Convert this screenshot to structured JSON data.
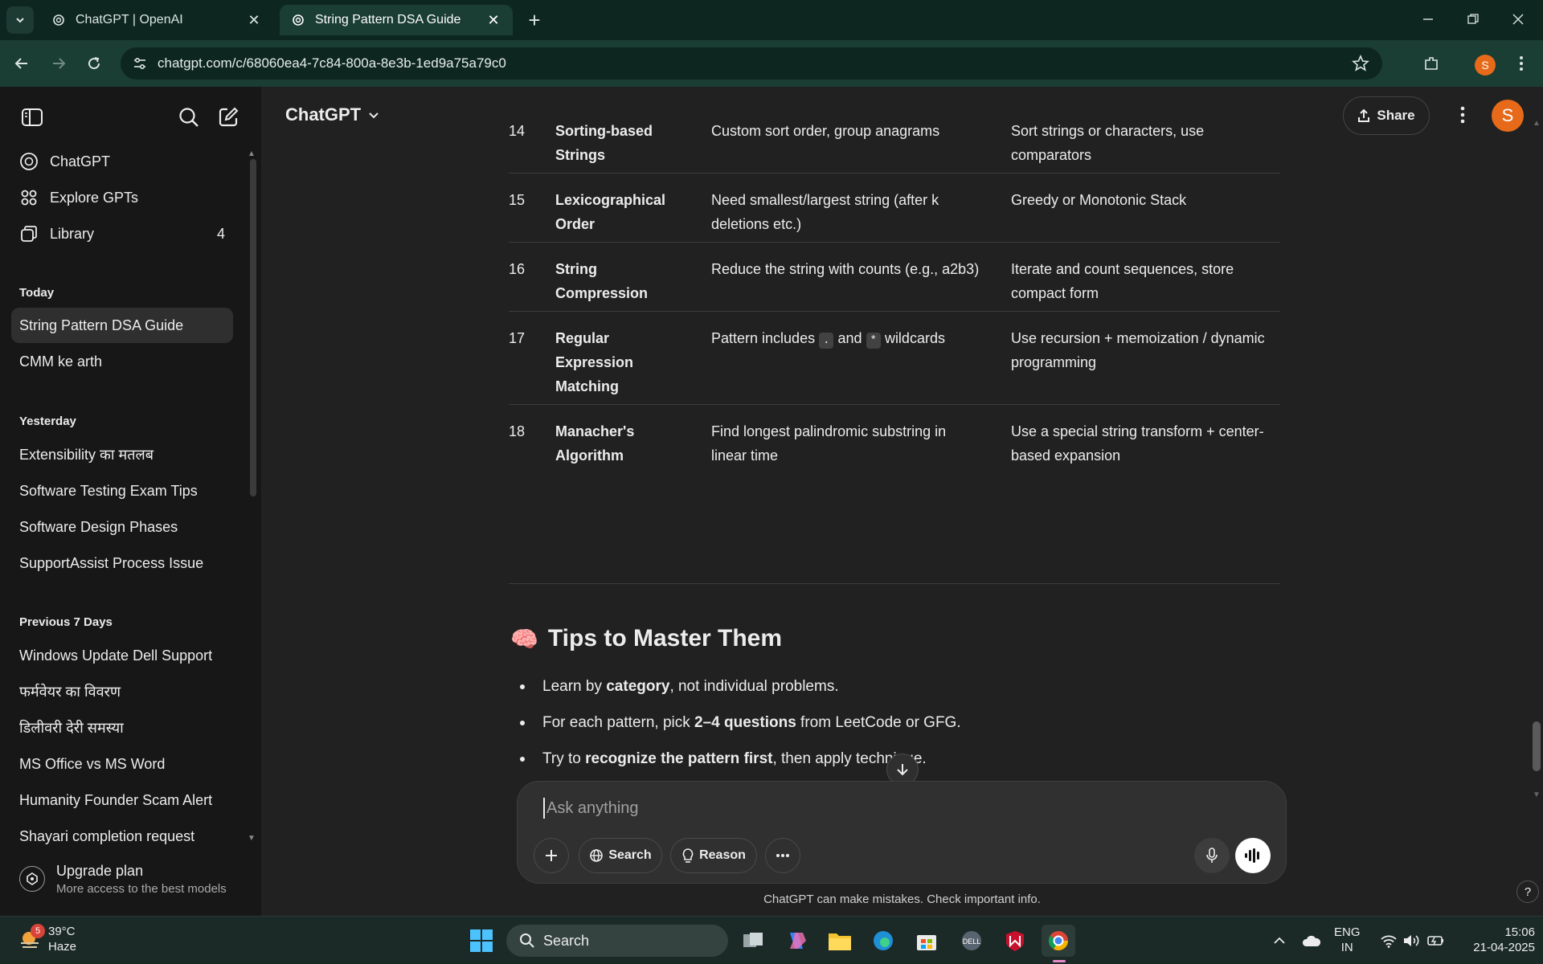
{
  "browser": {
    "tabs": [
      {
        "title": "ChatGPT | OpenAI"
      },
      {
        "title": "String Pattern DSA Guide"
      }
    ],
    "url": "chatgpt.com/c/68060ea4-7c84-800a-8e3b-1ed9a75a79c0",
    "profile_initial": "S"
  },
  "sidebar": {
    "nav": [
      {
        "label": "ChatGPT",
        "icon": "openai-icon"
      },
      {
        "label": "Explore GPTs",
        "icon": "grid-icon"
      },
      {
        "label": "Library",
        "icon": "library-icon",
        "count": "4"
      }
    ],
    "sections": [
      {
        "title": "Today",
        "items": [
          "String Pattern DSA Guide",
          "CMM ke arth"
        ]
      },
      {
        "title": "Yesterday",
        "items": [
          "Extensibility का मतलब",
          "Software Testing Exam Tips",
          "Software Design Phases",
          "SupportAssist Process Issue"
        ]
      },
      {
        "title": "Previous 7 Days",
        "items": [
          "Windows Update Dell Support",
          "फर्मवेयर का विवरण",
          "डिलीवरी देरी समस्या",
          "MS Office vs MS Word",
          "Humanity Founder Scam Alert",
          "Shayari completion request"
        ]
      }
    ],
    "upgrade": {
      "title": "Upgrade plan",
      "subtitle": "More access to the best models"
    }
  },
  "header": {
    "title": "ChatGPT",
    "share_label": "Share",
    "user_initial": "S"
  },
  "table_rows": [
    {
      "num": "14",
      "pattern": "Sorting-based Strings",
      "when": "Custom sort order, group anagrams",
      "how": "Sort strings or characters, use comparators"
    },
    {
      "num": "15",
      "pattern": "Lexicographical Order",
      "when": "Need smallest/largest string (after k deletions etc.)",
      "how": "Greedy or Monotonic Stack"
    },
    {
      "num": "16",
      "pattern": "String Compression",
      "when": "Reduce the string with counts (e.g., a2b3)",
      "how": "Iterate and count sequences, store compact form"
    },
    {
      "num": "17",
      "pattern": "Regular Expression Matching",
      "when_parts": [
        "Pattern includes ",
        ".",
        " and ",
        "*",
        " wildcards"
      ],
      "how": "Use recursion + memoization / dynamic programming"
    },
    {
      "num": "18",
      "pattern": "Manacher's Algorithm",
      "when": "Find longest palindromic substring in linear time",
      "how": "Use a special string transform + center-based expansion"
    }
  ],
  "tips": {
    "emoji": "🧠",
    "heading": "Tips to Master Them",
    "bullets": [
      {
        "pre": "Learn by ",
        "bold": "category",
        "post": ", not individual problems."
      },
      {
        "pre": "For each pattern, pick ",
        "bold": "2–4 questions",
        "post": " from LeetCode or GFG."
      },
      {
        "pre": "Try to ",
        "bold": "recognize the pattern first",
        "post": ", then apply technique."
      }
    ]
  },
  "composer": {
    "placeholder": "Ask anything",
    "search_label": "Search",
    "reason_label": "Reason"
  },
  "disclaimer": "ChatGPT can make mistakes. Check important info.",
  "help_label": "?",
  "taskbar": {
    "weather_temp": "39°C",
    "weather_desc": "Haze",
    "weather_badge": "5",
    "search_label": "Search",
    "lang1": "ENG",
    "lang2": "IN",
    "time": "15:06",
    "date": "21-04-2025"
  },
  "colors": {
    "accent": "#e66a1a",
    "tabbar": "#0e2620",
    "addressbar": "#1a3d34",
    "sidebar": "#171717",
    "main": "#212121"
  }
}
